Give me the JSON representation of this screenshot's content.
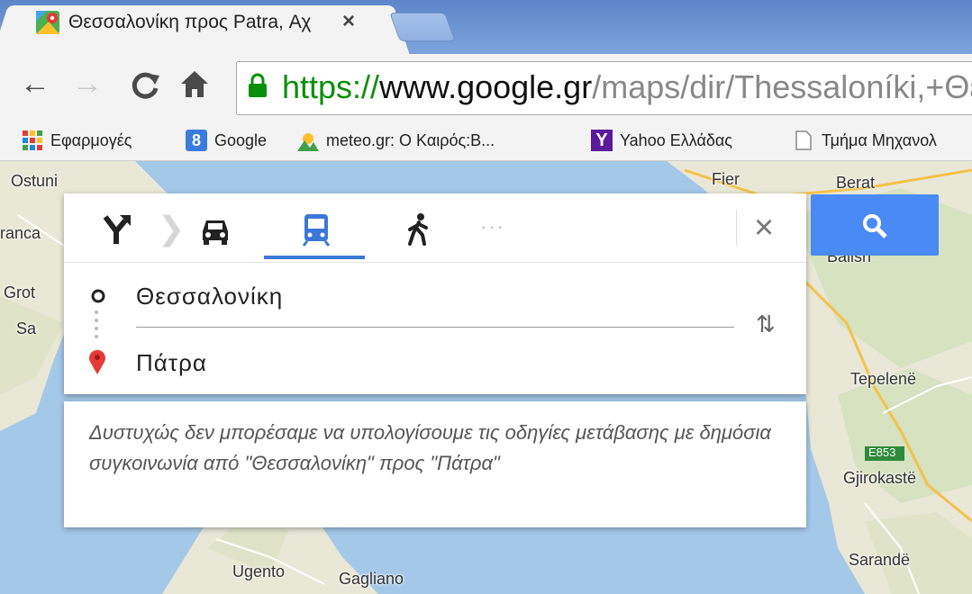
{
  "browser": {
    "tab_title": "Θεσσαλονίκη προς Patra, Αχ",
    "url_scheme": "https://",
    "url_host": "www.google.gr",
    "url_path": "/maps/dir/Thessaloníki,+Θεσ",
    "bookmarks": [
      {
        "label": "Εφαρμογές",
        "icon": "apps-grid-icon"
      },
      {
        "label": "Google",
        "icon": "google-icon"
      },
      {
        "label": "meteo.gr: Ο Καιρός:Β...",
        "icon": "meteo-icon"
      },
      {
        "label": "Yahoo Ελλάδας",
        "icon": "yahoo-icon"
      },
      {
        "label": "Τμήμα Μηχανολ",
        "icon": "page-icon"
      }
    ]
  },
  "directions": {
    "origin": "Θεσσαλονίκη",
    "destination": "Πάτρα",
    "modes_dots": "···",
    "selected_mode": "transit",
    "error_message": "Δυστυχώς δεν μπορέσαμε να υπολογίσουμε τις οδηγίες μετάβασης με δημόσια συγκοινωνία από \"Θεσσαλονίκη\" προς \"Πάτρα\""
  },
  "map": {
    "labels": {
      "ostuni": "Ostuni",
      "franca": "ranca",
      "grot": "Grot",
      "sa": "Sa",
      "fier": "Fier",
      "berat": "Berat",
      "ballsh": "Ballsh",
      "tepelene": "Tepelenë",
      "e853": "E853",
      "gjirokaste": "Gjirokastë",
      "sarande": "Sarandë",
      "ugento": "Ugento",
      "gagliano": "Gagliano"
    }
  },
  "colors": {
    "accent": "#4a8af4",
    "transit_selected": "#3a78d8",
    "url_secure": "#0a8f0a",
    "pin_red": "#e53935"
  }
}
